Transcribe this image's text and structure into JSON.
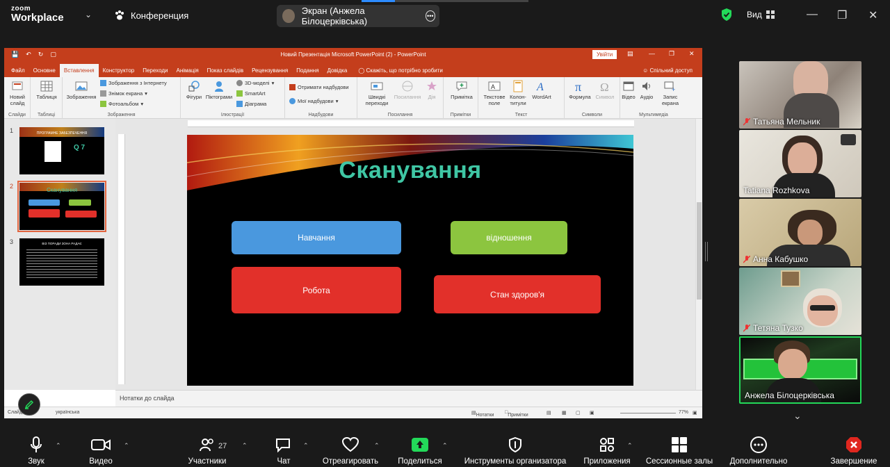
{
  "zoom": {
    "logo_line1": "zoom",
    "logo_line2": "Workplace",
    "conference_label": "Конференция",
    "screen_share_label": "Экран (Анжела Білоцерківська)",
    "view_label": "Вид",
    "security_color": "#23d959"
  },
  "ppt": {
    "window_title": "Новий Презентація Microsoft PowerPoint (2)  -  PowerPoint",
    "signin_label": "Увійти",
    "tabs": [
      "Файл",
      "Основне",
      "Вставлення",
      "Конструктор",
      "Переходи",
      "Анімація",
      "Показ слайдів",
      "Рецензування",
      "Подання",
      "Довідка"
    ],
    "active_tab": "Вставлення",
    "tell_me": "Скажіть, що потрібно зробити",
    "share_label": "Спільний доступ",
    "ribbon": {
      "slides_group": {
        "new_slide": "Новий слайд",
        "label": "Слайди"
      },
      "tables_group": {
        "table": "Таблиця",
        "label": "Таблиці"
      },
      "images_group": {
        "images": "Зображення",
        "online_images": "Зображення з Інтернету",
        "screenshot": "Знімок екрана",
        "photo_album": "Фотоальбом",
        "label": "Зображення"
      },
      "illustrations_group": {
        "shapes": "Фігури",
        "icons": "Піктограми",
        "models3d": "3D-моделі",
        "smartart": "SmartArt",
        "chart": "Діаграма",
        "label": "Ілюстрації"
      },
      "addins_group": {
        "get_addins": "Отримати надбудови",
        "my_addins": "Мої надбудови",
        "label": "Надбудови"
      },
      "links_group": {
        "zoom": "Швидкі переходи",
        "link": "Посилання",
        "action": "Дія",
        "label": "Посилання"
      },
      "comments_group": {
        "comment": "Примітка",
        "label": "Примітки"
      },
      "text_group": {
        "textbox": "Текстове поле",
        "header_footer": "Колон-титули",
        "wordart": "WordArt",
        "label": "Текст"
      },
      "symbols_group": {
        "equation": "Формула",
        "symbol": "Символ",
        "label": "Символи"
      },
      "media_group": {
        "video": "Відео",
        "audio": "Аудіо",
        "screen_recording": "Запис екрана",
        "label": "Мультимедіа"
      }
    },
    "thumbnails": [
      {
        "num": "1",
        "title": "ПРОГРАМНЕ ЗАБЕЗПЕЧЕННЯ",
        "sub": "Q 7"
      },
      {
        "num": "2",
        "title": "Сканування"
      },
      {
        "num": "3",
        "title": "ВІЗ ПОРАДИ ЗОНА РАДАЄ"
      }
    ],
    "slide": {
      "title": "Сканування",
      "buttons": [
        {
          "label": "Навчання",
          "color": "#4a98de"
        },
        {
          "label": "відношення",
          "color": "#8cc53f"
        },
        {
          "label": "Робота",
          "color": "#e2302a"
        },
        {
          "label": "Стан здоров'я",
          "color": "#e2302a"
        }
      ]
    },
    "notes_placeholder": "Нотатки до слайда",
    "status": {
      "slide": "Слайд 2 з 3",
      "language": "українська",
      "notes": "Нотатки",
      "comments": "Примітки",
      "zoom": "77%"
    }
  },
  "participants": [
    {
      "name": "Татьяна Мельник",
      "muted": true
    },
    {
      "name": "Tatiana Rozhkova",
      "muted": false
    },
    {
      "name": "Анна Кабушко",
      "muted": true
    },
    {
      "name": "Тетяна Тузко",
      "muted": true
    },
    {
      "name": "Анжела Білоцерківська",
      "muted": false,
      "active": true
    }
  ],
  "toolbar": {
    "audio": "Звук",
    "video": "Видео",
    "participants": "Участники",
    "participants_count": "27",
    "chat": "Чат",
    "react": "Отреагировать",
    "share": "Поделиться",
    "host_tools": "Инструменты организатора",
    "apps": "Приложения",
    "breakout": "Сессионные залы",
    "more": "Дополнительно",
    "end": "Завершение"
  }
}
